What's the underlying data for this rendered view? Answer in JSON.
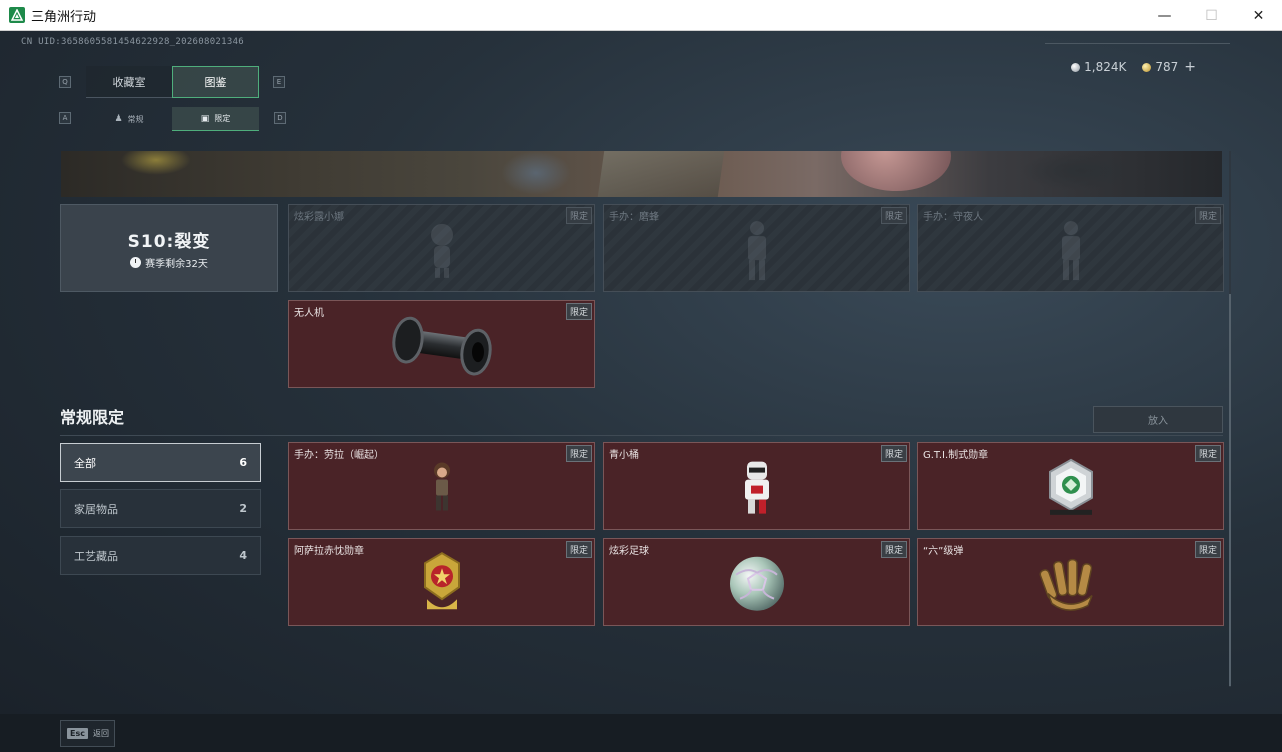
{
  "window": {
    "title": "三角洲行动",
    "controls": [
      "minimize-icon",
      "maximize-icon",
      "close-icon"
    ]
  },
  "header": {
    "uid": "CN UID:3658605581454622928_202608021346",
    "currency": [
      {
        "icon": "silver-coin-icon",
        "value": "1,824K"
      },
      {
        "icon": "gold-coin-icon",
        "value": "787"
      }
    ],
    "plus_label": "+"
  },
  "tabs": {
    "key_left": "Q",
    "key_right": "E",
    "items": [
      {
        "label": "收藏室",
        "active": false
      },
      {
        "label": "图鉴",
        "active": true
      }
    ]
  },
  "subtabs": {
    "key_left": "A",
    "key_right": "D",
    "items": [
      {
        "label": "常规",
        "icon": "figure-icon",
        "active": false
      },
      {
        "label": "限定",
        "icon": "image-icon",
        "active": true
      }
    ]
  },
  "season": {
    "title": "S10:裂变",
    "remaining": "赛季剩余32天"
  },
  "season_items": [
    {
      "name": "炫彩露小娜",
      "tag": "限定",
      "state": "locked"
    },
    {
      "name": "手办：磨蜂",
      "tag": "限定",
      "state": "locked"
    },
    {
      "name": "手办：守夜人",
      "tag": "限定",
      "state": "locked"
    },
    {
      "name": "无人机",
      "tag": "限定",
      "state": "owned"
    }
  ],
  "regular": {
    "title": "常规限定",
    "put_button": "放入",
    "filters": [
      {
        "label": "全部",
        "count": "6",
        "active": true
      },
      {
        "label": "家居物品",
        "count": "2",
        "active": false
      },
      {
        "label": "工艺藏品",
        "count": "4",
        "active": false
      }
    ],
    "items": [
      {
        "name": "手办：劳拉（崛起）",
        "tag": "限定"
      },
      {
        "name": "青小桶",
        "tag": "限定"
      },
      {
        "name": "G.T.I.制式勋章",
        "tag": "限定"
      },
      {
        "name": "阿萨拉赤忱勋章",
        "tag": "限定"
      },
      {
        "name": "炫彩足球",
        "tag": "限定"
      },
      {
        "name": "“六”级弹",
        "tag": "限定"
      }
    ]
  },
  "footer": {
    "esc_key": "Esc",
    "back_label": "返回"
  }
}
